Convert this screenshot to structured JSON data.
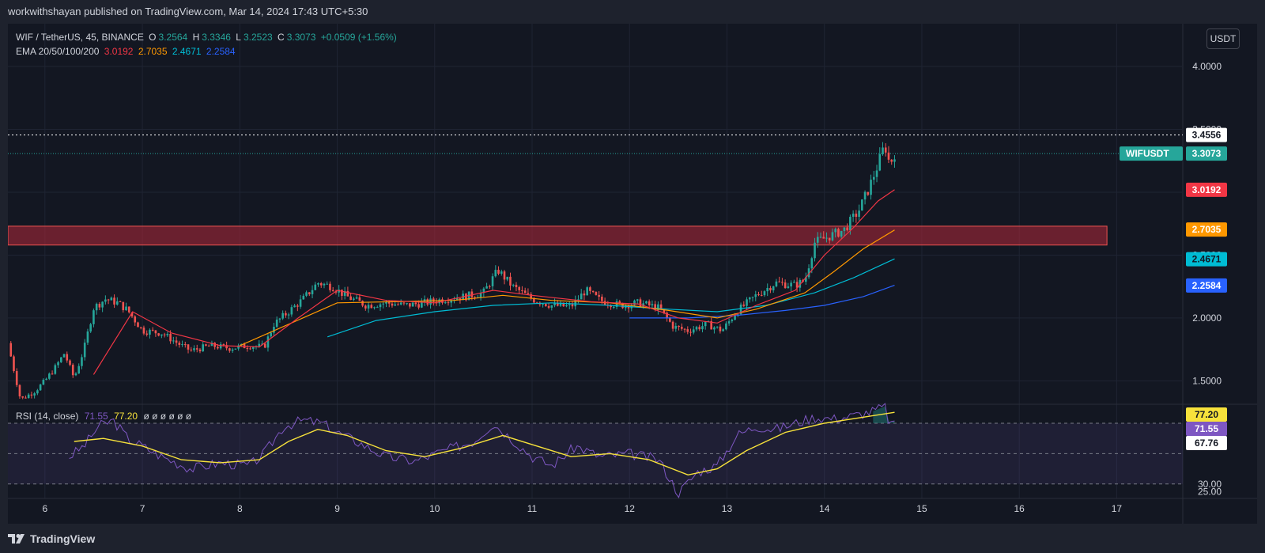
{
  "header": {
    "publisher_line": "workwithshayan published on TradingView.com, Mar 14, 2024 17:43 UTC+5:30"
  },
  "footer": {
    "brand": "TradingView"
  },
  "toolbar": {
    "currency_button": "USDT"
  },
  "legend": {
    "symbol": "WIF / TetherUS, 45, BINANCE",
    "open_label": "O",
    "open": "3.2564",
    "high_label": "H",
    "high": "3.3346",
    "low_label": "L",
    "low": "3.2523",
    "close_label": "C",
    "close": "3.3073",
    "change": "+0.0509 (+1.56%)",
    "ema_label": "EMA 20/50/100/200",
    "ema20": "3.0192",
    "ema50": "2.7035",
    "ema100": "2.4671",
    "ema200": "2.2584"
  },
  "rsi_legend": {
    "label": "RSI (14, close)",
    "rsi": "71.55",
    "ma": "77.20",
    "empties": "ø ø ø ø ø ø"
  },
  "colors": {
    "up": "#26a69a",
    "down": "#ef5350",
    "ema20": "#f23645",
    "ema50": "#ff9800",
    "ema100": "#00bcd4",
    "ema200": "#2962ff",
    "rsi": "#7e57c2",
    "rsi_ma": "#f7e23b",
    "zone": "#b2283b"
  },
  "chart_data": [
    {
      "type": "candlestick",
      "title": "WIF / TetherUS, 45, BINANCE",
      "x_tick_labels": [
        "6",
        "7",
        "8",
        "9",
        "10",
        "11",
        "12",
        "13",
        "14",
        "15",
        "16",
        "17"
      ],
      "x_ticks": [
        6,
        7,
        8,
        9,
        10,
        11,
        12,
        13,
        14,
        15,
        16,
        17
      ],
      "xlim": [
        5.62,
        17.67
      ],
      "y_tick_labels": [
        "1.5000",
        "2.0000",
        "2.5000",
        "3.5000",
        "4.0000"
      ],
      "y_ticks": [
        1.5,
        2.0,
        2.5,
        3.5,
        4.0
      ],
      "ylim": [
        1.32,
        4.34
      ],
      "current_price": {
        "label": "WIFUSDT",
        "value": 3.3073,
        "text": "3.3073"
      },
      "high_line": {
        "value": 3.4556,
        "text": "3.4556"
      },
      "resistance_zone": {
        "from": 2.58,
        "to": 2.73,
        "x_start": 5.62,
        "x_end": 16.9
      },
      "ema_labels": [
        {
          "name": "EMA 20",
          "value": 3.0192,
          "text": "3.0192"
        },
        {
          "name": "EMA 50",
          "value": 2.7035,
          "text": "2.7035"
        },
        {
          "name": "EMA 100",
          "value": 2.4671,
          "text": "2.4671"
        },
        {
          "name": "EMA 200",
          "value": 2.2584,
          "text": "2.2584"
        }
      ],
      "price_path": [
        [
          5.62,
          1.8
        ],
        [
          5.75,
          1.35
        ],
        [
          5.9,
          1.42
        ],
        [
          6.0,
          1.5
        ],
        [
          6.1,
          1.6
        ],
        [
          6.2,
          1.72
        ],
        [
          6.3,
          1.52
        ],
        [
          6.4,
          1.75
        ],
        [
          6.5,
          2.08
        ],
        [
          6.62,
          2.15
        ],
        [
          6.75,
          2.12
        ],
        [
          6.85,
          2.06
        ],
        [
          7.0,
          1.9
        ],
        [
          7.2,
          1.88
        ],
        [
          7.4,
          1.78
        ],
        [
          7.5,
          1.74
        ],
        [
          7.7,
          1.78
        ],
        [
          7.9,
          1.76
        ],
        [
          8.1,
          1.78
        ],
        [
          8.25,
          1.77
        ],
        [
          8.35,
          1.95
        ],
        [
          8.5,
          2.05
        ],
        [
          8.65,
          2.15
        ],
        [
          8.8,
          2.28
        ],
        [
          8.95,
          2.25
        ],
        [
          9.1,
          2.17
        ],
        [
          9.3,
          2.1
        ],
        [
          9.5,
          2.12
        ],
        [
          9.7,
          2.1
        ],
        [
          9.9,
          2.12
        ],
        [
          10.1,
          2.15
        ],
        [
          10.3,
          2.17
        ],
        [
          10.5,
          2.2
        ],
        [
          10.65,
          2.38
        ],
        [
          10.8,
          2.25
        ],
        [
          11.0,
          2.15
        ],
        [
          11.2,
          2.1
        ],
        [
          11.4,
          2.09
        ],
        [
          11.55,
          2.22
        ],
        [
          11.7,
          2.14
        ],
        [
          11.9,
          2.1
        ],
        [
          12.1,
          2.12
        ],
        [
          12.3,
          2.08
        ],
        [
          12.45,
          1.93
        ],
        [
          12.6,
          1.9
        ],
        [
          12.8,
          1.95
        ],
        [
          12.95,
          1.9
        ],
        [
          13.1,
          2.05
        ],
        [
          13.3,
          2.18
        ],
        [
          13.5,
          2.28
        ],
        [
          13.7,
          2.26
        ],
        [
          13.8,
          2.3
        ],
        [
          13.9,
          2.6
        ],
        [
          14.05,
          2.65
        ],
        [
          14.2,
          2.7
        ],
        [
          14.35,
          2.85
        ],
        [
          14.45,
          3.02
        ],
        [
          14.55,
          3.22
        ],
        [
          14.62,
          3.38
        ],
        [
          14.67,
          3.22
        ],
        [
          14.72,
          3.31
        ]
      ],
      "ema_series": {
        "ema20": [
          [
            6.5,
            1.55
          ],
          [
            6.9,
            2.05
          ],
          [
            7.3,
            1.88
          ],
          [
            7.8,
            1.78
          ],
          [
            8.2,
            1.77
          ],
          [
            8.6,
            2.0
          ],
          [
            9.0,
            2.22
          ],
          [
            9.5,
            2.14
          ],
          [
            10.0,
            2.12
          ],
          [
            10.6,
            2.22
          ],
          [
            11.0,
            2.18
          ],
          [
            11.6,
            2.13
          ],
          [
            12.1,
            2.11
          ],
          [
            12.5,
            2.0
          ],
          [
            12.9,
            1.96
          ],
          [
            13.3,
            2.1
          ],
          [
            13.7,
            2.22
          ],
          [
            14.0,
            2.5
          ],
          [
            14.3,
            2.72
          ],
          [
            14.55,
            2.93
          ],
          [
            14.72,
            3.02
          ]
        ],
        "ema50": [
          [
            8.0,
            1.78
          ],
          [
            8.5,
            1.95
          ],
          [
            9.0,
            2.12
          ],
          [
            9.6,
            2.13
          ],
          [
            10.2,
            2.14
          ],
          [
            10.7,
            2.18
          ],
          [
            11.2,
            2.14
          ],
          [
            11.8,
            2.12
          ],
          [
            12.4,
            2.06
          ],
          [
            12.9,
            2.0
          ],
          [
            13.3,
            2.07
          ],
          [
            13.8,
            2.2
          ],
          [
            14.1,
            2.37
          ],
          [
            14.4,
            2.55
          ],
          [
            14.72,
            2.7
          ]
        ],
        "ema100": [
          [
            8.9,
            1.85
          ],
          [
            9.4,
            1.98
          ],
          [
            10.0,
            2.05
          ],
          [
            10.6,
            2.1
          ],
          [
            11.2,
            2.12
          ],
          [
            11.8,
            2.1
          ],
          [
            12.4,
            2.07
          ],
          [
            12.9,
            2.05
          ],
          [
            13.4,
            2.1
          ],
          [
            13.9,
            2.2
          ],
          [
            14.3,
            2.32
          ],
          [
            14.72,
            2.47
          ]
        ],
        "ema200": [
          [
            12.0,
            2.0
          ],
          [
            12.6,
            2.0
          ],
          [
            13.1,
            2.02
          ],
          [
            13.6,
            2.06
          ],
          [
            14.0,
            2.1
          ],
          [
            14.4,
            2.17
          ],
          [
            14.72,
            2.26
          ]
        ]
      }
    },
    {
      "type": "line",
      "title": "RSI (14, close)",
      "ylim": [
        20.5,
        82
      ],
      "y_tick_labels": [
        "25.00",
        "30.00"
      ],
      "y_ticks": [
        25,
        30
      ],
      "band": [
        30,
        70
      ],
      "value_labels": [
        {
          "name": "RSI MA",
          "value": 77.2,
          "text": "77.20"
        },
        {
          "name": "RSI",
          "value": 71.55,
          "text": "71.55"
        },
        {
          "name": "Level",
          "value": 67.76,
          "text": "67.76"
        }
      ],
      "rsi_path": [
        [
          6.25,
          48
        ],
        [
          6.4,
          55
        ],
        [
          6.55,
          68
        ],
        [
          6.7,
          72
        ],
        [
          6.85,
          60
        ],
        [
          7.0,
          55
        ],
        [
          7.2,
          48
        ],
        [
          7.5,
          40
        ],
        [
          7.8,
          44
        ],
        [
          8.1,
          42
        ],
        [
          8.25,
          50
        ],
        [
          8.45,
          68
        ],
        [
          8.65,
          72
        ],
        [
          8.85,
          70
        ],
        [
          9.0,
          64
        ],
        [
          9.2,
          58
        ],
        [
          9.5,
          48
        ],
        [
          9.8,
          45
        ],
        [
          10.1,
          52
        ],
        [
          10.4,
          58
        ],
        [
          10.6,
          70
        ],
        [
          10.75,
          62
        ],
        [
          11.0,
          48
        ],
        [
          11.2,
          42
        ],
        [
          11.45,
          55
        ],
        [
          11.7,
          48
        ],
        [
          12.0,
          50
        ],
        [
          12.3,
          46
        ],
        [
          12.5,
          24
        ],
        [
          12.7,
          38
        ],
        [
          12.9,
          42
        ],
        [
          13.1,
          62
        ],
        [
          13.3,
          68
        ],
        [
          13.5,
          66
        ],
        [
          13.7,
          70
        ],
        [
          13.9,
          74
        ],
        [
          14.1,
          73
        ],
        [
          14.3,
          75
        ],
        [
          14.5,
          78
        ],
        [
          14.62,
          81
        ],
        [
          14.67,
          69
        ],
        [
          14.72,
          71.55
        ]
      ],
      "rsi_ma_path": [
        [
          6.3,
          58
        ],
        [
          6.6,
          60
        ],
        [
          7.0,
          55
        ],
        [
          7.4,
          46
        ],
        [
          7.8,
          44
        ],
        [
          8.2,
          46
        ],
        [
          8.5,
          58
        ],
        [
          8.8,
          66
        ],
        [
          9.1,
          62
        ],
        [
          9.5,
          52
        ],
        [
          9.9,
          48
        ],
        [
          10.3,
          54
        ],
        [
          10.7,
          62
        ],
        [
          11.0,
          56
        ],
        [
          11.4,
          48
        ],
        [
          11.8,
          50
        ],
        [
          12.2,
          46
        ],
        [
          12.6,
          36
        ],
        [
          12.9,
          40
        ],
        [
          13.2,
          52
        ],
        [
          13.6,
          64
        ],
        [
          14.0,
          70
        ],
        [
          14.4,
          74
        ],
        [
          14.72,
          77.2
        ]
      ]
    }
  ]
}
